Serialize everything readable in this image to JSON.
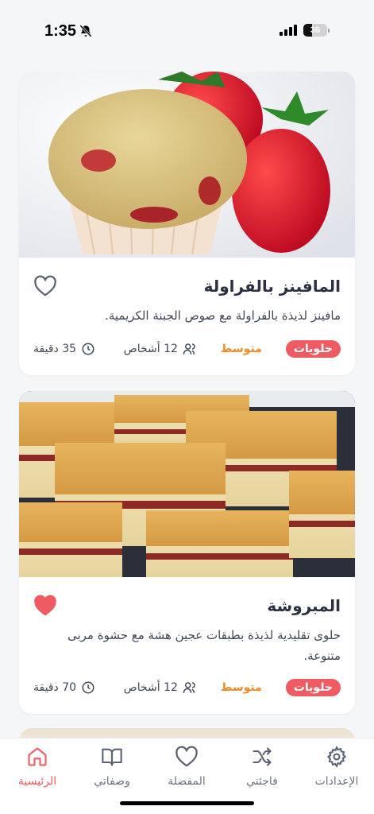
{
  "status_bar": {
    "time": "1:35",
    "battery_level": "36"
  },
  "recipes": [
    {
      "title": "المافينز بالفراولة",
      "description": "مافينز لذيذة بالفراولة مع صوص الجبنة الكريمية.",
      "category": "حلويات",
      "difficulty": "متوسط",
      "servings": "12 أشخاص",
      "time": "35 دقيقة",
      "favorite": false,
      "image_icon": "strawberry-muffin-photo"
    },
    {
      "title": "المبروشة",
      "description": "حلوى تقليدية لذيذة بطبقات عجين هشة مع حشوة مربى متنوعة.",
      "category": "حلويات",
      "difficulty": "متوسط",
      "servings": "12 أشخاص",
      "time": "70 دقيقة",
      "favorite": true,
      "image_icon": "mbesses-cake-photo"
    }
  ],
  "tabs": [
    {
      "label": "الإعدادات",
      "icon": "gear-icon"
    },
    {
      "label": "فاجئني",
      "icon": "shuffle-icon"
    },
    {
      "label": "المفضلة",
      "icon": "heart-icon"
    },
    {
      "label": "وصفاتي",
      "icon": "book-icon"
    },
    {
      "label": "الرئيسية",
      "icon": "home-icon",
      "active": true
    }
  ],
  "colors": {
    "accent": "#ef5b62",
    "difficulty": "#f08a24",
    "text": "#2b3140"
  }
}
